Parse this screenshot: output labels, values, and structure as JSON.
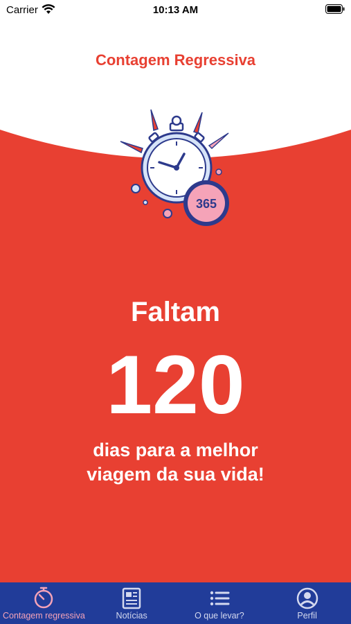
{
  "status_bar": {
    "carrier": "Carrier",
    "time": "10:13 AM"
  },
  "header": {
    "title": "Contagem Regressiva"
  },
  "illustration": {
    "badge_text": "365"
  },
  "countdown": {
    "label": "Faltam",
    "days": "120",
    "message_line1": "dias para a melhor",
    "message_line2": "viagem da sua vida!"
  },
  "tab_bar": {
    "tabs": [
      {
        "label": "Contagem regressiva",
        "icon": "stopwatch-icon",
        "active": true
      },
      {
        "label": "Notícias",
        "icon": "newspaper-icon",
        "active": false
      },
      {
        "label": "O que levar?",
        "icon": "list-icon",
        "active": false
      },
      {
        "label": "Perfil",
        "icon": "profile-icon",
        "active": false
      }
    ]
  },
  "colors": {
    "brand_red": "#e84032",
    "tab_bar_blue": "#213c99",
    "tab_active_pink": "#f5a3b8"
  }
}
